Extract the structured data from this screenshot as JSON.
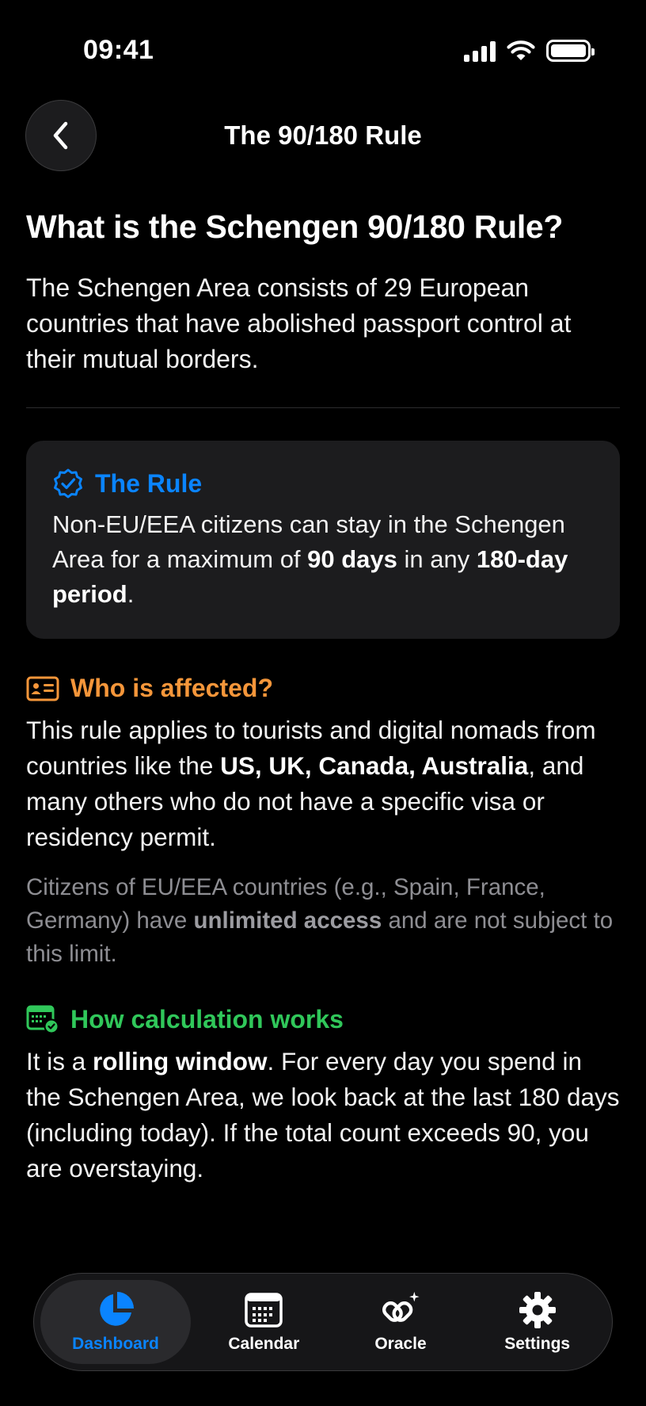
{
  "status": {
    "time": "09:41"
  },
  "header": {
    "title": "The 90/180 Rule"
  },
  "content": {
    "heading": "What is the Schengen 90/180 Rule?",
    "intro": "The Schengen Area consists of 29 European countries that have abolished passport control at their mutual borders.",
    "rule": {
      "title": "The Rule",
      "text_1": "Non-EU/EEA citizens can stay in the Schengen Area for a maximum of ",
      "bold_1": "90 days",
      "text_2": " in any ",
      "bold_2": "180-day period",
      "text_3": "."
    },
    "affected": {
      "title": "Who is affected?",
      "text_1": "This rule applies to tourists and digital nomads from countries like the ",
      "bold_1": "US, UK, Canada, Australia",
      "text_2": ", and many others who do not have a specific visa or residency permit.",
      "note_1": "Citizens of EU/EEA countries (e.g., Spain, France, Germany) have ",
      "note_bold": "unlimited access",
      "note_2": " and are not subject to this limit."
    },
    "calculation": {
      "title": "How calculation works",
      "text_1": "It is a ",
      "bold_1": "rolling window",
      "text_2": ". For every day you spend in the Schengen Area, we look back at the last 180 days (including today). If the total count exceeds 90, you are overstaying."
    }
  },
  "tabs": [
    {
      "label": "Dashboard",
      "icon": "pie-chart-icon",
      "active": true
    },
    {
      "label": "Calendar",
      "icon": "calendar-icon",
      "active": false
    },
    {
      "label": "Oracle",
      "icon": "oracle-sparkle-icon",
      "active": false
    },
    {
      "label": "Settings",
      "icon": "gear-icon",
      "active": false
    }
  ],
  "colors": {
    "accent": "#0a84ff",
    "affected": "#f5963a",
    "calculation": "#30c75a",
    "background": "#000000",
    "card": "#1c1c1e"
  }
}
